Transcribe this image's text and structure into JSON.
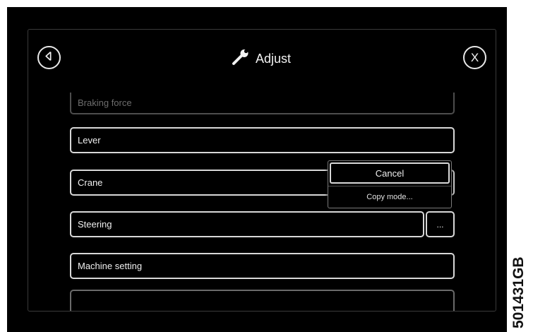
{
  "header": {
    "title": "Adjust",
    "title_icon": "wrench-icon",
    "back_icon": "back-arrow-icon",
    "close_label": "X"
  },
  "menu": {
    "items": [
      {
        "label": "Braking force"
      },
      {
        "label": "Lever"
      },
      {
        "label": "Crane"
      },
      {
        "label": "Steering"
      },
      {
        "label": "Machine setting"
      }
    ],
    "more_button_label": "..."
  },
  "popup": {
    "cancel_label": "Cancel",
    "copy_mode_label": "Copy mode..."
  },
  "figure_code": "501431GB",
  "colors": {
    "background": "#000000",
    "foreground": "#f0f0f0",
    "muted": "#6d6d6d"
  }
}
